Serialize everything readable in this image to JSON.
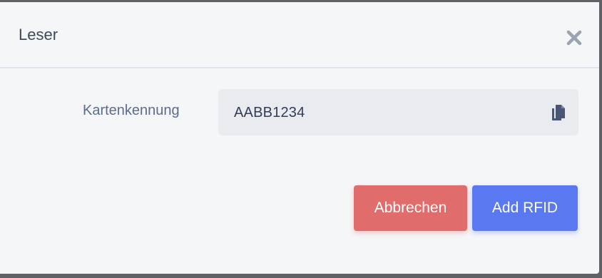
{
  "modal": {
    "title": "Leser",
    "close_icon": "close-icon"
  },
  "field": {
    "label": "Kartenkennung",
    "value": "AABB1234",
    "copy_icon": "copy-icon"
  },
  "buttons": {
    "cancel_label": "Abbrechen",
    "add_label": "Add RFID"
  },
  "colors": {
    "cancel": "#e06c6c",
    "primary": "#5a78ef",
    "background": "#f5f6f8"
  }
}
